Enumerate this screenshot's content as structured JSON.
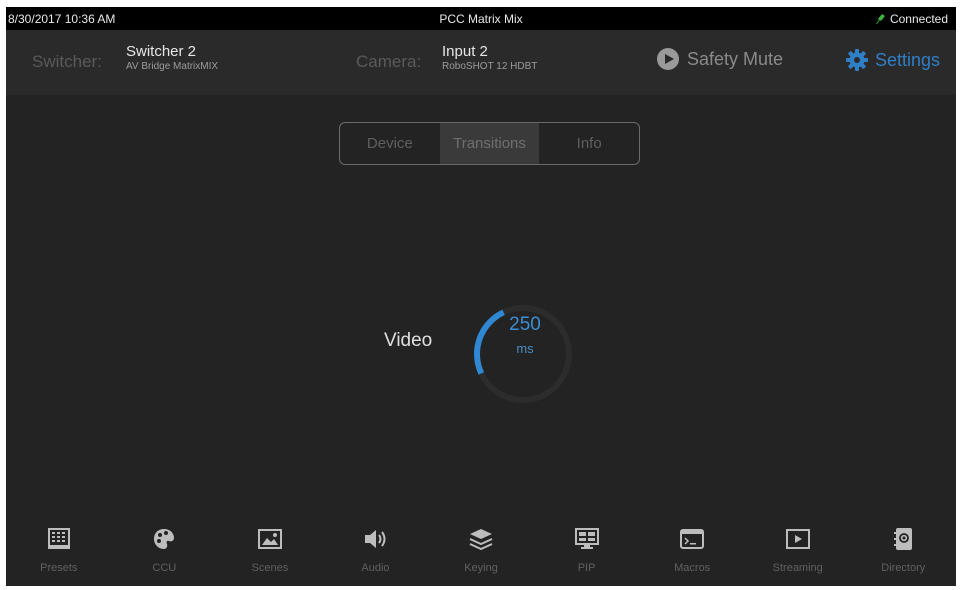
{
  "status_bar": {
    "datetime": "8/30/2017 10:36 AM",
    "title": "PCC Matrix Mix",
    "connection": "Connected",
    "connection_color": "#3db43d"
  },
  "header": {
    "switcher_label": "Switcher:",
    "switcher_name": "Switcher 2",
    "switcher_model": "AV Bridge MatrixMIX",
    "camera_label": "Camera:",
    "camera_name": "Input 2",
    "camera_model": "RoboSHOT 12 HDBT",
    "safety_mute": "Safety Mute",
    "settings": "Settings",
    "accent_color": "#2f7fc7"
  },
  "tabs": [
    {
      "label": "Device",
      "active": false
    },
    {
      "label": "Transitions",
      "active": true
    },
    {
      "label": "Info",
      "active": false
    }
  ],
  "transition": {
    "label": "Video",
    "value": "250",
    "unit": "ms",
    "dial_fraction": 0.25
  },
  "bottom_nav": [
    {
      "label": "Presets",
      "icon": "presets-grid-icon"
    },
    {
      "label": "CCU",
      "icon": "palette-icon"
    },
    {
      "label": "Scenes",
      "icon": "scene-picture-icon"
    },
    {
      "label": "Audio",
      "icon": "speaker-icon"
    },
    {
      "label": "Keying",
      "icon": "layers-icon"
    },
    {
      "label": "PIP",
      "icon": "pip-monitor-icon"
    },
    {
      "label": "Macros",
      "icon": "terminal-icon"
    },
    {
      "label": "Streaming",
      "icon": "play-screen-icon"
    },
    {
      "label": "Directory",
      "icon": "address-book-icon"
    }
  ]
}
